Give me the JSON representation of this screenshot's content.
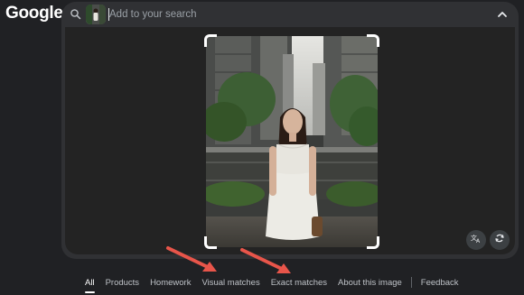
{
  "logo_text": "Google",
  "search": {
    "placeholder": "Add to your search"
  },
  "icons": {
    "search": "search-icon",
    "collapse": "chevron-up-icon",
    "translate": "translate-icon",
    "rotate": "rotate-icon"
  },
  "tabs": [
    {
      "label": "All",
      "active": true
    },
    {
      "label": "Products"
    },
    {
      "label": "Homework"
    },
    {
      "label": "Visual matches"
    },
    {
      "label": "Exact matches"
    },
    {
      "label": "About this image"
    },
    {
      "label": "Feedback"
    }
  ],
  "colors": {
    "annotation_arrow": "#e8554a",
    "background": "#202124"
  }
}
